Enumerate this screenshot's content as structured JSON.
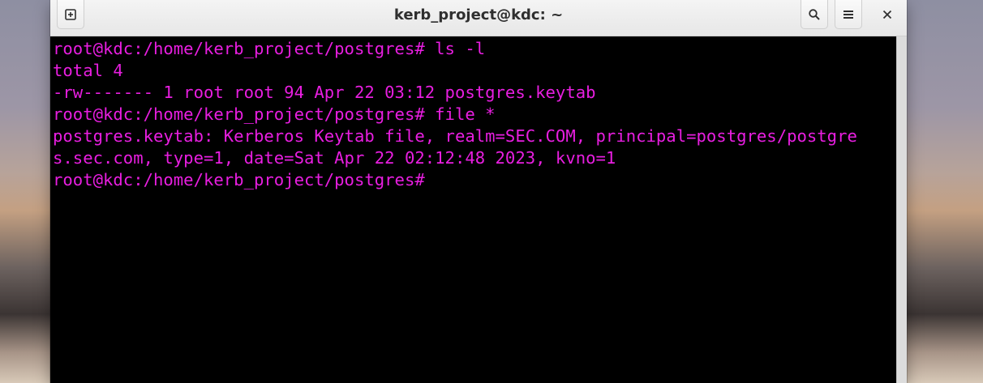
{
  "window": {
    "title": "kerb_project@kdc: ~"
  },
  "titlebar_buttons": {
    "new_tab_icon": "new-tab-icon",
    "search_icon": "search-icon",
    "menu_icon": "hamburger-menu-icon",
    "close_glyph": "✕"
  },
  "terminal": {
    "text_color": "#e81ee0",
    "background": "#000000",
    "lines": [
      "root@kdc:/home/kerb_project/postgres# ls -l",
      "total 4",
      "-rw------- 1 root root 94 Apr 22 03:12 postgres.keytab",
      "root@kdc:/home/kerb_project/postgres# file *",
      "postgres.keytab: Kerberos Keytab file, realm=SEC.COM, principal=postgres/postgre",
      "s.sec.com, type=1, date=Sat Apr 22 02:12:48 2023, kvno=1",
      "root@kdc:/home/kerb_project/postgres# "
    ]
  }
}
